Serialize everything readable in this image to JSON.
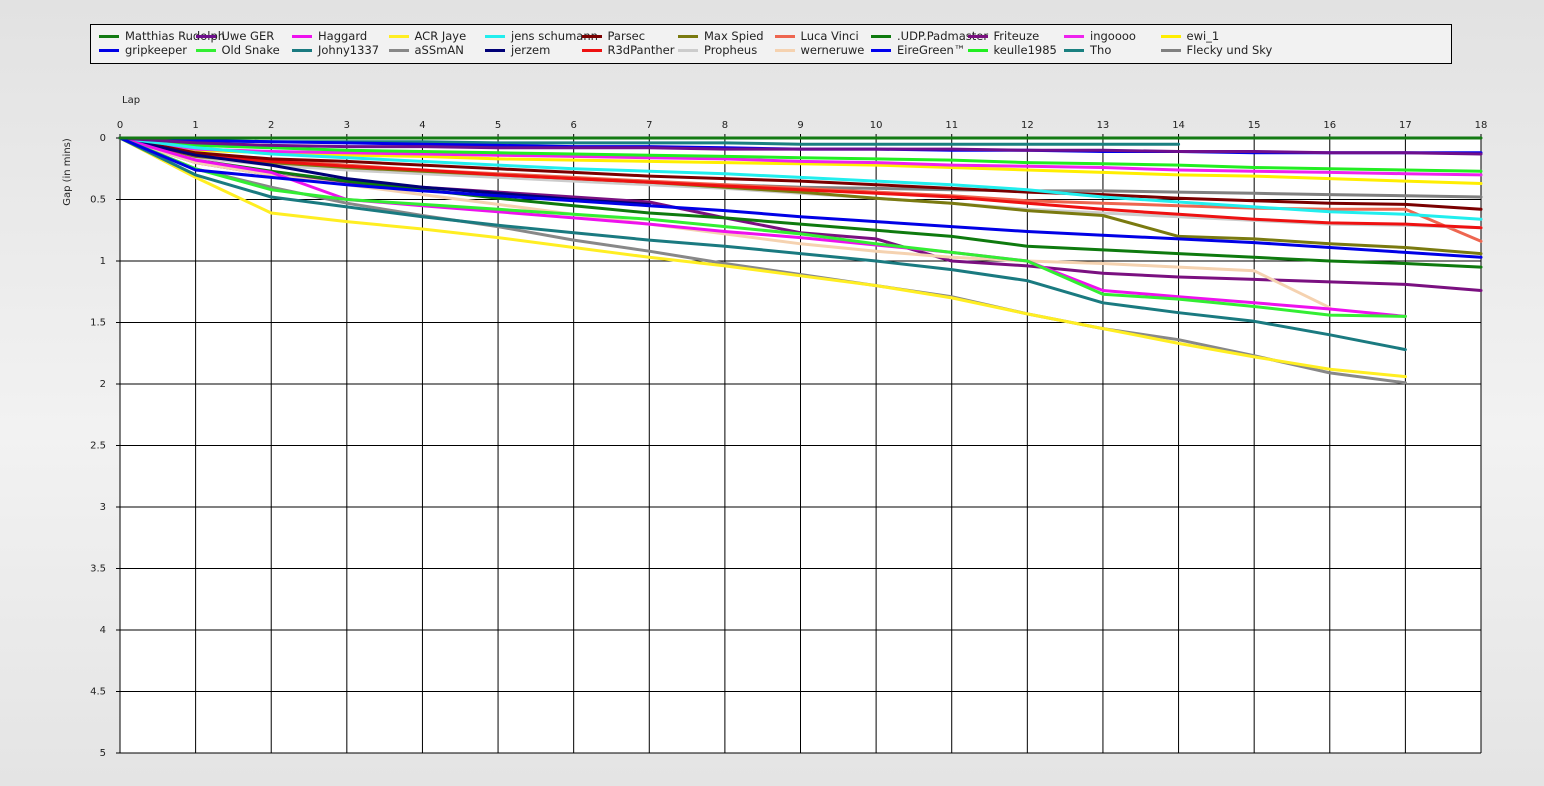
{
  "chart_data": {
    "type": "line",
    "title": "",
    "xlabel": "Lap",
    "ylabel": "Gap (in mins)",
    "x": [
      0,
      1,
      2,
      3,
      4,
      5,
      6,
      7,
      8,
      9,
      10,
      11,
      12,
      13,
      14,
      15,
      16,
      17,
      18
    ],
    "x_ticks": [
      "0",
      "1",
      "2",
      "3",
      "4",
      "5",
      "6",
      "7",
      "8",
      "9",
      "10",
      "11",
      "12",
      "13",
      "14",
      "15",
      "16",
      "17",
      "18"
    ],
    "y_ticks": [
      "0",
      "0.5",
      "1",
      "1.5",
      "2",
      "2.5",
      "3",
      "3.5",
      "4",
      "4.5",
      "5"
    ],
    "xlim": [
      0,
      18
    ],
    "ylim": [
      0,
      5
    ],
    "y_reversed": true,
    "grid": true,
    "legend_position": "top",
    "series": [
      {
        "name": "Matthias Rudolph",
        "color": "#137a13",
        "values": [
          0,
          0,
          0,
          0,
          0,
          0,
          0,
          0,
          0,
          0,
          0,
          0,
          0,
          0,
          0,
          0,
          0,
          0,
          0
        ]
      },
      {
        "name": "gripkeeper",
        "color": "#0000e6",
        "values": [
          0,
          0.26,
          0.32,
          0.38,
          0.43,
          0.47,
          0.51,
          0.55,
          0.59,
          0.64,
          0.68,
          0.72,
          0.76,
          0.79,
          0.82,
          0.85,
          0.89,
          0.93,
          0.97
        ]
      },
      {
        "name": "Uwe GER",
        "color": "#6e0e8c",
        "values": [
          0,
          0.04,
          0.06,
          0.07,
          0.07,
          0.08,
          0.08,
          0.08,
          0.09,
          0.09,
          0.09,
          0.09,
          0.1,
          0.1,
          0.11,
          0.11,
          0.12,
          0.12,
          0.13
        ]
      },
      {
        "name": "Old Snake",
        "color": "#33ee33",
        "values": [
          0,
          0.25,
          0.42,
          0.5,
          0.54,
          0.58,
          0.62,
          0.66,
          0.72,
          0.78,
          0.86,
          0.93,
          1.0,
          1.27,
          1.31,
          1.37,
          1.44,
          1.45,
          null
        ]
      },
      {
        "name": "Haggard",
        "color": "#ee11ee",
        "values": [
          0,
          0.18,
          0.28,
          0.5,
          0.55,
          0.6,
          0.65,
          0.7,
          0.76,
          0.81,
          0.87,
          0.93,
          1.0,
          1.24,
          1.29,
          1.34,
          1.39,
          1.45,
          null
        ]
      },
      {
        "name": "Johny1337",
        "color": "#1a7a80",
        "values": [
          0,
          0.3,
          0.48,
          0.56,
          0.64,
          0.71,
          0.77,
          0.83,
          0.88,
          0.94,
          1.0,
          1.07,
          1.16,
          1.34,
          1.42,
          1.49,
          1.6,
          1.72,
          null
        ]
      },
      {
        "name": "ACR Jaye",
        "color": "#ffee22",
        "values": [
          0,
          0.32,
          0.61,
          0.68,
          0.74,
          0.81,
          0.89,
          0.97,
          1.04,
          1.12,
          1.2,
          1.3,
          1.43,
          1.55,
          1.67,
          1.78,
          1.88,
          1.94,
          null
        ]
      },
      {
        "name": "aSSmAN",
        "color": "#888888",
        "values": [
          0,
          0.25,
          0.4,
          0.53,
          0.63,
          0.72,
          0.83,
          0.92,
          1.02,
          1.11,
          1.2,
          1.29,
          1.43,
          1.55,
          1.64,
          1.77,
          1.91,
          1.99,
          null
        ]
      },
      {
        "name": "jens schumann",
        "color": "#22eeee",
        "values": [
          0,
          0.08,
          0.13,
          0.16,
          0.19,
          0.22,
          0.25,
          0.27,
          0.29,
          0.32,
          0.35,
          0.38,
          0.42,
          0.48,
          0.52,
          0.56,
          0.6,
          0.62,
          0.66
        ]
      },
      {
        "name": "jerzem",
        "color": "#000077",
        "values": [
          0,
          0.14,
          0.22,
          0.33,
          0.4,
          0.45,
          0.5,
          0.54,
          null,
          null,
          null,
          null,
          null,
          null,
          null,
          null,
          null,
          null,
          null
        ]
      },
      {
        "name": "Parsec",
        "color": "#7a0000",
        "values": [
          0,
          0.12,
          0.17,
          0.19,
          0.22,
          0.25,
          0.28,
          0.31,
          0.33,
          0.35,
          0.38,
          0.41,
          0.44,
          0.46,
          0.49,
          0.51,
          0.53,
          0.54,
          0.58
        ]
      },
      {
        "name": "R3dPanther",
        "color": "#ee1111",
        "values": [
          0,
          0.14,
          0.19,
          0.23,
          0.26,
          0.3,
          0.33,
          0.36,
          0.39,
          0.42,
          0.45,
          0.48,
          0.53,
          0.58,
          0.62,
          0.66,
          0.69,
          0.7,
          0.73
        ]
      },
      {
        "name": "Max Spied",
        "color": "#7a7a10",
        "values": [
          0,
          0.15,
          0.2,
          0.24,
          0.27,
          0.3,
          0.33,
          0.36,
          0.4,
          0.44,
          0.49,
          0.53,
          0.59,
          0.63,
          0.8,
          0.82,
          0.86,
          0.89,
          0.94
        ]
      },
      {
        "name": "Propheus",
        "color": "#cccccc",
        "values": [
          0,
          0.16,
          0.22,
          0.26,
          0.29,
          0.32,
          0.35,
          0.38,
          0.41,
          0.45,
          0.49,
          0.53,
          0.58,
          0.61,
          0.64,
          0.67,
          0.7,
          0.71,
          0.73
        ]
      },
      {
        "name": "Luca Vinci",
        "color": "#ee6650",
        "values": [
          0,
          0.13,
          0.18,
          0.22,
          0.26,
          0.29,
          0.32,
          0.35,
          0.38,
          0.41,
          0.44,
          0.47,
          0.51,
          0.53,
          0.55,
          0.57,
          0.58,
          0.58,
          0.84
        ]
      },
      {
        "name": "werneruwe",
        "color": "#f5d2b0",
        "values": [
          0,
          0.2,
          0.3,
          0.38,
          0.46,
          0.54,
          0.62,
          0.7,
          0.78,
          0.86,
          0.92,
          0.97,
          1.0,
          1.02,
          1.05,
          1.08,
          1.38,
          null,
          null
        ]
      },
      {
        "name": ".UDP.Padmaster",
        "color": "#0e7a0e",
        "values": [
          0,
          0.18,
          0.27,
          0.35,
          0.42,
          0.49,
          0.55,
          0.61,
          0.65,
          0.7,
          0.75,
          0.8,
          0.88,
          0.91,
          0.94,
          0.97,
          1.0,
          1.02,
          1.05
        ]
      },
      {
        "name": "EireGreen™",
        "color": "#0000ee",
        "values": [
          0,
          0.02,
          0.03,
          0.04,
          0.05,
          0.06,
          0.07,
          0.07,
          0.08,
          0.09,
          0.09,
          0.1,
          0.1,
          0.11,
          0.11,
          0.12,
          0.12,
          0.12,
          0.12
        ]
      },
      {
        "name": "Friteuze",
        "color": "#7a1080",
        "values": [
          0,
          0.2,
          0.3,
          0.36,
          0.4,
          0.44,
          0.48,
          0.52,
          0.65,
          0.77,
          0.82,
          1.0,
          1.04,
          1.1,
          1.13,
          1.15,
          1.17,
          1.19,
          1.24
        ]
      },
      {
        "name": "keulle1985",
        "color": "#22ee22",
        "values": [
          0,
          0.06,
          0.08,
          0.1,
          0.11,
          0.12,
          0.13,
          0.14,
          0.15,
          0.16,
          0.17,
          0.18,
          0.2,
          0.21,
          0.22,
          0.24,
          0.25,
          0.26,
          0.27
        ]
      },
      {
        "name": "ingoooo",
        "color": "#ee22ee",
        "values": [
          0,
          0.09,
          0.11,
          0.12,
          0.13,
          0.14,
          0.15,
          0.16,
          0.17,
          0.19,
          0.2,
          0.22,
          0.23,
          0.24,
          0.26,
          0.27,
          0.28,
          0.29,
          0.3
        ]
      },
      {
        "name": "Tho",
        "color": "#1a8080",
        "values": [
          0,
          0.02,
          0.03,
          0.03,
          0.03,
          0.04,
          0.04,
          0.04,
          0.04,
          0.05,
          0.05,
          0.05,
          0.05,
          0.05,
          0.05,
          null,
          null,
          null,
          null
        ]
      },
      {
        "name": "ewi_1",
        "color": "#ffee00",
        "values": [
          0,
          0.1,
          0.12,
          0.14,
          0.15,
          0.17,
          0.18,
          0.19,
          0.2,
          0.21,
          0.22,
          0.24,
          0.26,
          0.28,
          0.3,
          0.31,
          0.33,
          0.35,
          0.37
        ]
      },
      {
        "name": "Flecky und Sky",
        "color": "#808080",
        "values": [
          0,
          0.15,
          0.21,
          0.25,
          0.28,
          0.31,
          0.34,
          0.36,
          0.38,
          0.4,
          0.41,
          0.42,
          0.43,
          0.43,
          0.44,
          0.45,
          0.46,
          0.47,
          0.48
        ]
      }
    ]
  }
}
